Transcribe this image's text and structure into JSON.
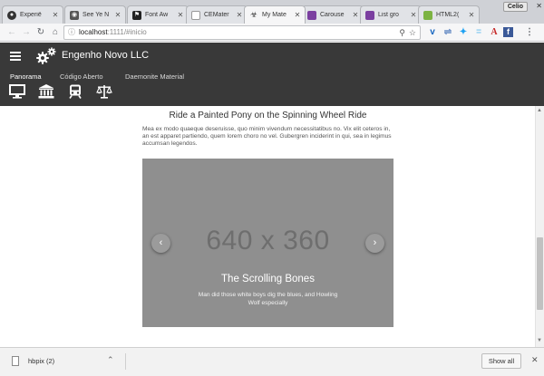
{
  "tabs": [
    {
      "label": "Experiê",
      "icon": "github-icon",
      "color": "#333333"
    },
    {
      "label": "See Ye N",
      "icon": "eye-icon",
      "color": "#444444"
    },
    {
      "label": "Font Aw",
      "icon": "flag-icon",
      "color": "#222222"
    },
    {
      "label": "CEMater",
      "icon": "page-icon",
      "color": "#9e9e9e"
    },
    {
      "label": "My Mate",
      "icon": "biohazard-icon",
      "color": "#333333",
      "active": true
    },
    {
      "label": "Carouse",
      "icon": "purple-page-icon",
      "color": "#7b3fa0"
    },
    {
      "label": "List gro",
      "icon": "purple-page-icon",
      "color": "#7b3fa0"
    },
    {
      "label": "HTML2(",
      "icon": "green-page-icon",
      "color": "#7cb342"
    }
  ],
  "profile_badge": "Celio",
  "address": {
    "host": "localhost",
    "path": ":1111/#inicio"
  },
  "app": {
    "title": "Engenho Novo LLC",
    "tabs": [
      "Panorama",
      "Código Aberto",
      "Daemonite Material"
    ],
    "icons": [
      "desktop-icon",
      "bank-icon",
      "train-icon",
      "balance-scale-icon"
    ],
    "bar_color": "#393939"
  },
  "content": {
    "title": "Ride a Painted Pony on the Spinning Wheel Ride",
    "paragraph": "Mea ex modo quaeque deseruisse, quo minim vivendum necessitatibus no. Vix elit ceteros in, an est apparet partiendo, quem lorem choro no vel. Gubergren inciderint in qui, sea in legimus accumsan legendos."
  },
  "carousel": {
    "placeholder": "640 x 360",
    "caption_title": "The Scrolling Bones",
    "caption_text": "Man did those white boys dig the blues, and Howling Wolf especially",
    "prev_icon": "chevron-left-icon",
    "next_icon": "chevron-right-icon"
  },
  "download": {
    "file": "hbpix (2)",
    "show_all": "Show all"
  }
}
